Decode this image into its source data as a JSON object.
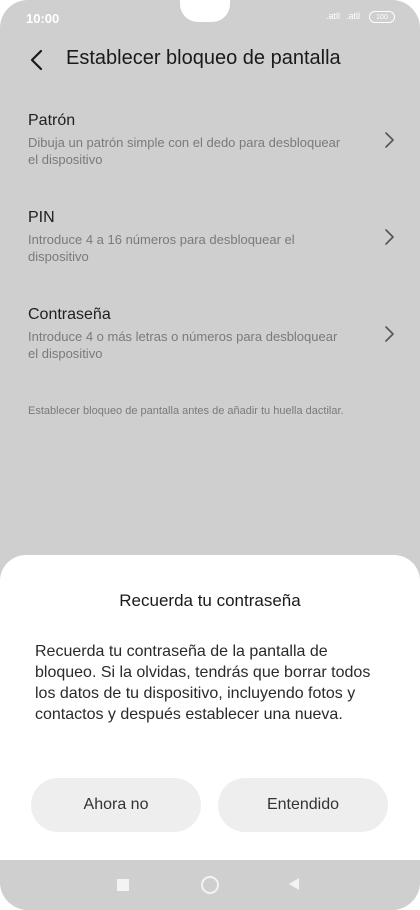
{
  "status_bar": {
    "time": "10:00",
    "signal_1": ".atll",
    "signal_2": ".atll",
    "battery": "100"
  },
  "header": {
    "title": "Establecer bloqueo de pantalla",
    "back_icon": "chevron-left-icon"
  },
  "options": [
    {
      "title": "Patrón",
      "description": "Dibuja un patrón simple con el dedo para desbloquear el dispositivo"
    },
    {
      "title": "PIN",
      "description": "Introduce 4 a 16 números para desbloquear el dispositivo"
    },
    {
      "title": "Contraseña",
      "description": "Introduce 4 o más letras o números para desbloquear el dispositivo"
    }
  ],
  "note": "Establecer bloqueo de pantalla antes de añadir tu huella dactilar.",
  "dialog": {
    "title": "Recuerda tu contraseña",
    "body": "Recuerda tu contraseña de la pantalla de bloqueo. Si la olvidas, tendrás que borrar todos los datos de tu dispositivo, incluyendo fotos y contactos y después establecer una nueva.",
    "cancel_label": "Ahora no",
    "confirm_label": "Entendido"
  },
  "colors": {
    "overlay_gray": "#cfcfcf",
    "sheet_bg": "#ffffff",
    "button_bg": "#eeeeee"
  }
}
